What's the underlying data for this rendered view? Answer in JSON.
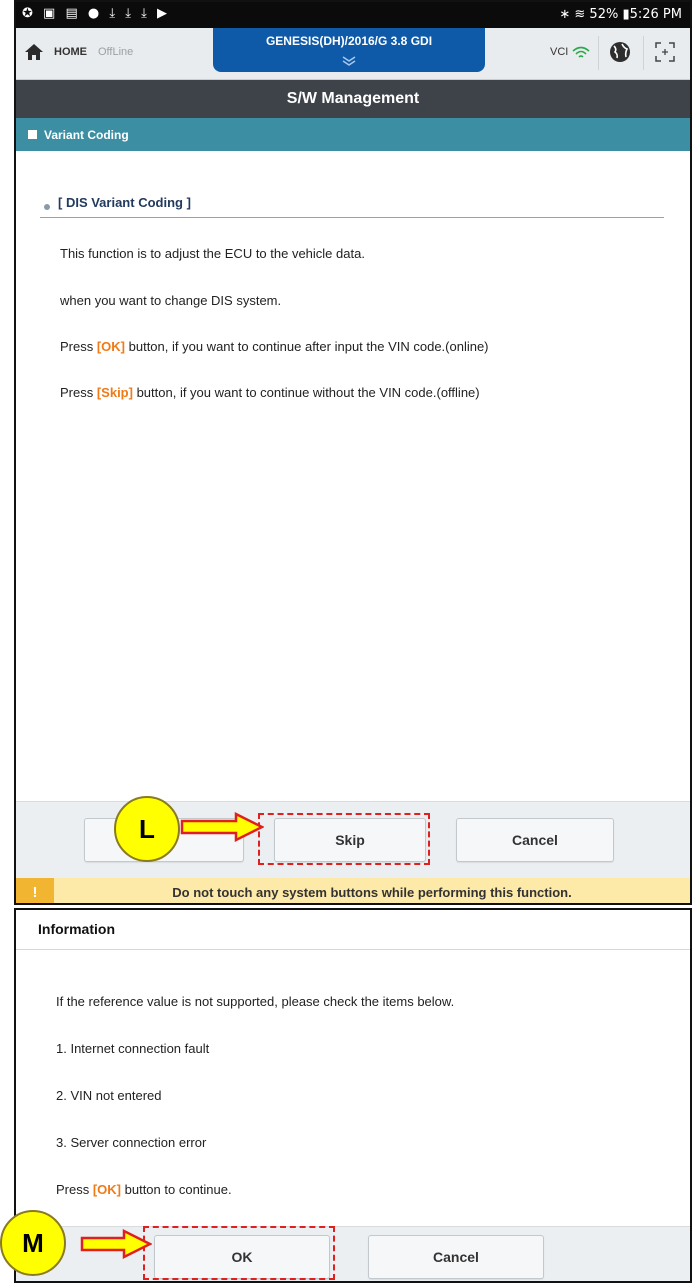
{
  "status_bar": {
    "left_icons": "✪ ▣ ▤ ● ⤓ ⤓ ⤓ ▶",
    "right_text": "∗ ≋ 52% ▮5:26 PM"
  },
  "app_bar": {
    "home_label": "HOME",
    "mode_label": "OffLine",
    "vehicle": "GENESIS(DH)/2016/G 3.8 GDI",
    "vci_label": "VCI",
    "icons": [
      "home-icon",
      "chevron-down-icon",
      "wifi-icon",
      "globe-icon",
      "expand-icon"
    ]
  },
  "title": "S/W Management",
  "section": "Variant Coding",
  "content": {
    "subtitle": "[ DIS Variant Coding ]",
    "lines": [
      "This function is to adjust the ECU to the vehicle data.",
      "when you want to change DIS system."
    ],
    "press_ok": {
      "prefix": "Press ",
      "key": "[OK]",
      "suffix": " button, if you want to continue after input the VIN code.(online)"
    },
    "press_skip": {
      "prefix": "Press ",
      "key": "[Skip]",
      "suffix": " button, if you want to continue without the VIN code.(offline)"
    }
  },
  "buttons": {
    "first": "",
    "skip": "Skip",
    "cancel": "Cancel"
  },
  "warning": {
    "icon": "!",
    "text": "Do not touch any system buttons while performing this function."
  },
  "info_dialog": {
    "title": "Information",
    "lines": [
      "If the reference value is not supported, please check the items below.",
      "1. Internet connection fault",
      "2. VIN not entered",
      "3. Server connection error"
    ],
    "press": {
      "prefix": "Press ",
      "key": "[OK]",
      "suffix": " button to continue."
    },
    "ok": "OK",
    "cancel": "Cancel"
  },
  "callouts": {
    "l": "L",
    "m": "M"
  },
  "colors": {
    "accent_orange": "#f07a16",
    "title_bar": "#3d4348",
    "section_bar": "#3c8fa3",
    "vehicle_tab": "#0f5aa8",
    "warning_bg": "#fde9a8",
    "callout_fill": "#ffff00",
    "highlight_border": "#e01f1f"
  }
}
